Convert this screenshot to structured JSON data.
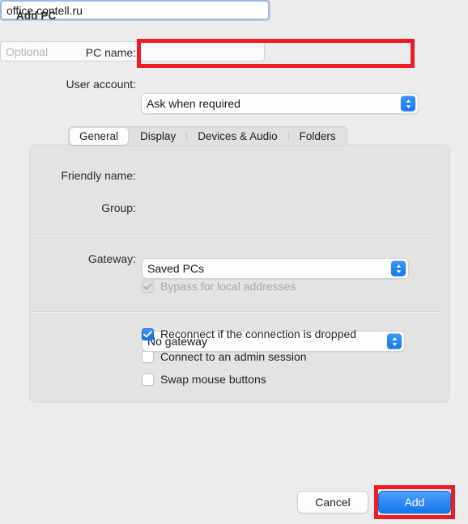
{
  "dialog": {
    "title": "Add PC"
  },
  "fields": {
    "pc_name": {
      "label": "PC name:",
      "value": "office.contell.ru",
      "placeholder": ""
    },
    "user_account": {
      "label": "User account:",
      "value": "Ask when required"
    },
    "friendly_name": {
      "label": "Friendly name:",
      "value": "",
      "placeholder": "Optional"
    },
    "group": {
      "label": "Group:",
      "value": "Saved PCs"
    },
    "gateway": {
      "label": "Gateway:",
      "value": "No gateway"
    }
  },
  "tabs": [
    {
      "label": "General",
      "selected": true
    },
    {
      "label": "Display",
      "selected": false
    },
    {
      "label": "Devices & Audio",
      "selected": false
    },
    {
      "label": "Folders",
      "selected": false
    }
  ],
  "checkboxes": {
    "bypass_local": {
      "label": "Bypass for local addresses",
      "checked": true,
      "enabled": false
    },
    "reconnect": {
      "label": "Reconnect if the connection is dropped",
      "checked": true,
      "enabled": true
    },
    "admin_session": {
      "label": "Connect to an admin session",
      "checked": false,
      "enabled": true
    },
    "swap_mouse": {
      "label": "Swap mouse buttons",
      "checked": false,
      "enabled": true
    }
  },
  "buttons": {
    "cancel": "Cancel",
    "add": "Add"
  },
  "icons": {
    "stepper": "updown-chevron-icon",
    "checkmark": "checkmark-icon"
  },
  "colors": {
    "accent_blue": "#1277ed",
    "annotation_red": "#ee1c25",
    "window_bg": "#ececec",
    "panel_bg": "#e3e3e3",
    "placeholder_gray": "#b4b4b4",
    "disabled_gray": "#a9a9a9"
  }
}
